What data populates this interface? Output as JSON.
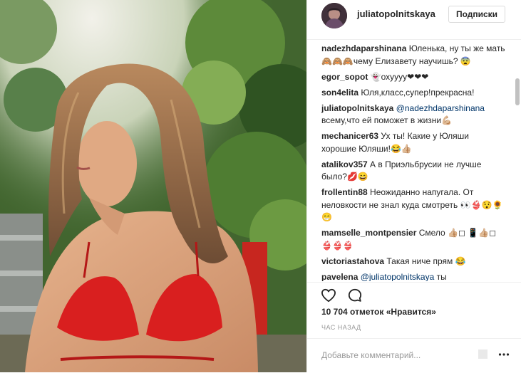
{
  "post": {
    "username": "juliatopolnitskaya",
    "follow_label": "Подписки"
  },
  "comments": [
    {
      "user": "nadezhdaparshinana",
      "text": " Юленька, ну ты же мать🙈🙈🙈чему Елизавету научишь? 😨"
    },
    {
      "user": "egor_sopot",
      "text": " 👻охуууу❤❤❤"
    },
    {
      "user": "son4elita",
      "text": " Юля,класс,супер!прекрасна!"
    },
    {
      "user": "juliatopolnitskaya",
      "mention": " @nadezhdaparshinana",
      "text": " всему,что ей поможет в жизни💪🏼"
    },
    {
      "user": "mechanicer63",
      "text": " Ух ты! Какие у Юляши хорошие Юляши!😂👍🏼"
    },
    {
      "user": "atalikov357",
      "text": " А в Приэльбрусии не лучше было?💋😄"
    },
    {
      "user": "frollentin88",
      "text": " Неожиданно напугала. От неловкости не знал куда смотреть 👀👙😯🌻😁"
    },
    {
      "user": "mamselle_montpensier",
      "text": " Смело 👍🏼◻ 📱👍🏼◻ 👙👙👙"
    },
    {
      "user": "victoriastahova",
      "text": " Такая ниче прям 😂"
    },
    {
      "user": "pavelena",
      "mention": " @juliatopolnitskaya",
      "text": " ты"
    }
  ],
  "stats": {
    "likes": "10 704 отметок «Нравится»",
    "time": "ЧАС НАЗАД"
  },
  "comment_box": {
    "placeholder": "Добавьте комментарий..."
  },
  "icons": {
    "like": "heart-icon",
    "comment": "comment-bubble-icon",
    "more": "more-options-icon"
  },
  "colors": {
    "swimsuit": "#d91f1f",
    "mention": "#003569",
    "text": "#262626",
    "muted": "#999999"
  }
}
